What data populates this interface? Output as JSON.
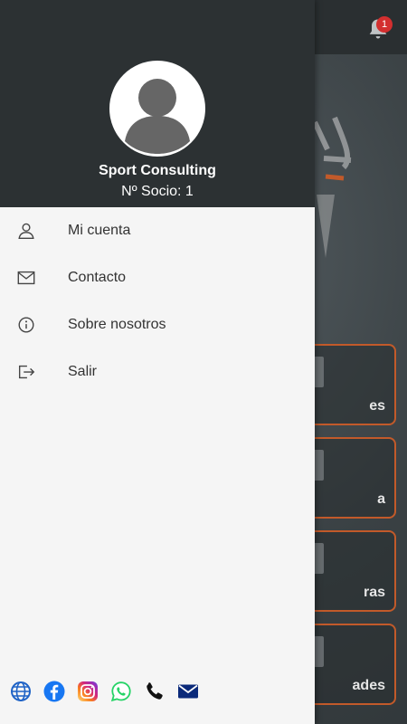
{
  "drawer": {
    "user_name": "Sport Consulting",
    "member_text": "Nº Socio: 1",
    "menu": [
      {
        "label": "Mi cuenta",
        "icon": "person-icon"
      },
      {
        "label": "Contacto",
        "icon": "mail-icon"
      },
      {
        "label": "Sobre nosotros",
        "icon": "info-icon"
      },
      {
        "label": "Salir",
        "icon": "logout-icon"
      }
    ],
    "social": [
      "globe-icon",
      "facebook-icon",
      "instagram-icon",
      "whatsapp-icon",
      "phone-icon",
      "email-icon"
    ]
  },
  "background": {
    "notification_count": "1",
    "tiles": [
      "es",
      "a",
      "ras",
      "ades"
    ]
  },
  "colors": {
    "drawer_header": "#2c3133",
    "drawer_body": "#f5f5f5",
    "tile_border": "#c25a2a",
    "badge": "#d32f2f"
  }
}
